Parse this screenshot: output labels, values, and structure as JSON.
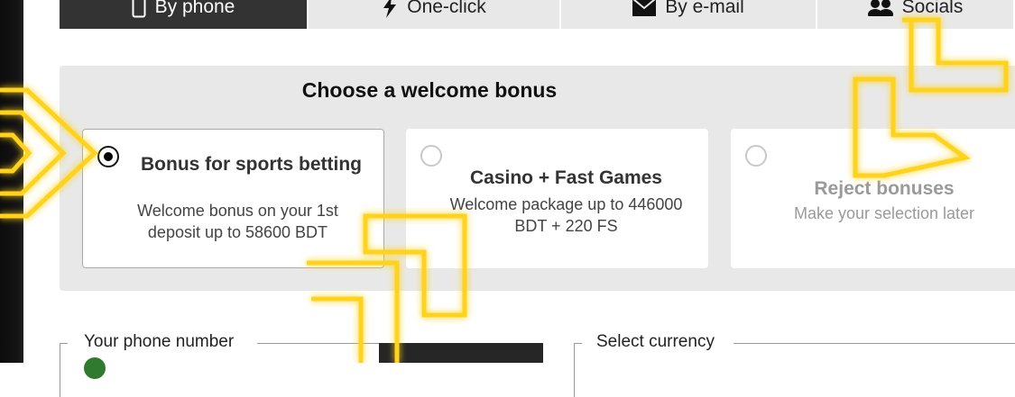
{
  "tabs": [
    {
      "label": "By phone",
      "icon": "phone-icon",
      "active": true
    },
    {
      "label": "One-click",
      "icon": "lightning-icon",
      "active": false
    },
    {
      "label": "By e-mail",
      "icon": "envelope-icon",
      "active": false
    },
    {
      "label": "Socials",
      "icon": "users-icon",
      "active": false
    }
  ],
  "bonus": {
    "title": "Choose a welcome bonus",
    "options": [
      {
        "title": "Bonus for sports betting",
        "description": "Welcome bonus on your 1st deposit up to 58600 BDT",
        "selected": true
      },
      {
        "title": "Casino + Fast Games",
        "description": "Welcome package up to 446000 BDT + 220 FS",
        "selected": false
      },
      {
        "title": "Reject bonuses",
        "description": "Make your selection later",
        "selected": false
      }
    ]
  },
  "form": {
    "phone_label": "Your phone number",
    "currency_label": "Select currency"
  },
  "colors": {
    "active_tab": "#333333",
    "panel": "#e8e8e8",
    "glow": "#ffd21a"
  }
}
